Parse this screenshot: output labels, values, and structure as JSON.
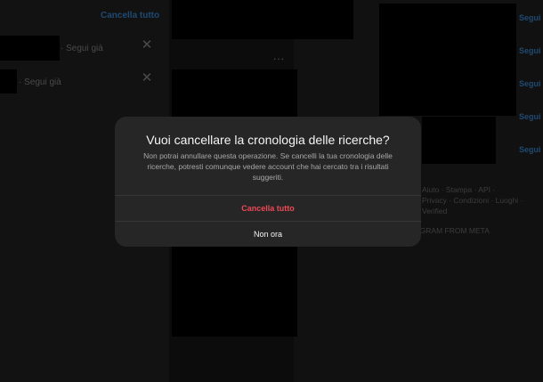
{
  "left_panel": {
    "clear_all_label": "Cancella tutto",
    "recent_items": [
      {
        "status": "· Segui già"
      },
      {
        "status": "· Segui già"
      }
    ],
    "remove_glyph": "✕"
  },
  "feed": {
    "more_glyph": "..."
  },
  "right_panel": {
    "follow_labels": [
      "Segui",
      "Segui",
      "Segui",
      "Segui",
      "Segui"
    ],
    "footer_links": {
      "line1": "Aiuto · Stampa · API ·",
      "line2": "Privacy · Condizioni · Luoghi ·",
      "line3": "Verified",
      "line4": "AGRAM FROM META"
    }
  },
  "modal": {
    "title": "Vuoi cancellare la cronologia delle ricerche?",
    "body": "Non potrai annullare questa operazione. Se cancelli la tua cronologia delle ricerche, potresti comunque vedere account che hai cercato tra i risultati suggeriti.",
    "confirm_label": "Cancella tutto",
    "cancel_label": "Non ora"
  },
  "colors": {
    "overlay": "#000000",
    "modal_bg": "#262626",
    "destructive": "#ed4956",
    "link_blue": "#1f4a73"
  }
}
